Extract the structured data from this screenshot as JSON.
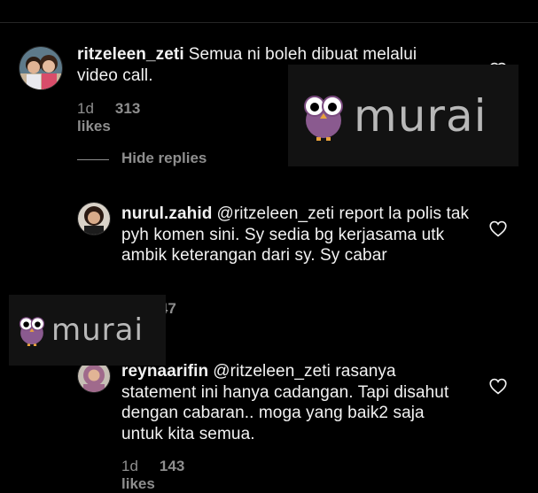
{
  "comments": [
    {
      "username": "ritzeleen_zeti",
      "text": "Semua ni boleh dibuat melalui video call.",
      "time": "1d",
      "likes": "313 likes",
      "avatar": "two-children-photo"
    },
    {
      "username": "nurul.zahid",
      "text": "@ritzeleen_zeti report la polis tak pyh komen sini. Sy sedia bg kerjasama utk ambik keterangan dari sy. Sy cabar",
      "time": "1d",
      "likes": "47 likes",
      "avatar": "woman-photo"
    },
    {
      "username": "reynaarifin",
      "text": "@ritzeleen_zeti rasanya statement ini hanya cadangan. Tapi disahut dengan cabaran.. moga yang baik2 saja untuk kita semua.",
      "time": "1d",
      "likes": "143 likes",
      "avatar": "woman-hijab-photo"
    }
  ],
  "hide_replies_label": "Hide replies",
  "watermark": {
    "text": "murai",
    "icon": "owl-icon",
    "color": "#b8b8b8",
    "owl_color": "#8a5a8f"
  },
  "icons": {
    "like": "heart-outline-icon"
  },
  "colors": {
    "background": "#000000",
    "text": "#f2f2f2",
    "meta": "#8e8e8e"
  }
}
